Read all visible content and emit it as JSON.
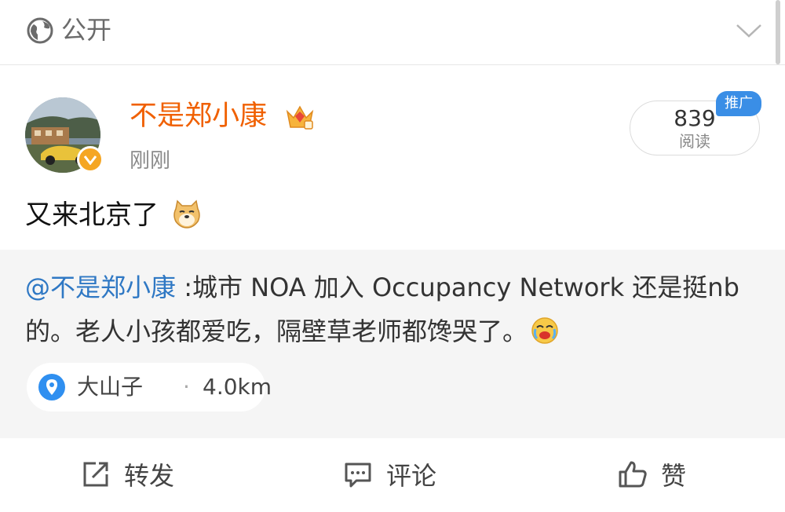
{
  "visibility": {
    "label": "公开"
  },
  "post": {
    "username": "不是郑小康",
    "time": "刚刚",
    "reads_count": "839",
    "reads_label": "阅读",
    "promo_label": "推广",
    "text": "又来北京了"
  },
  "repost": {
    "mention": "@不是郑小康",
    "text": " :城市 NOA 加入 Occupancy Network 还是挺nb 的。老人小孩都爱吃，隔壁草老师都馋哭了。",
    "location_name": "大山子",
    "location_separator": "·",
    "location_distance": "4.0km"
  },
  "actions": {
    "forward": "转发",
    "comment": "评论",
    "like": "赞"
  },
  "colors": {
    "username": "#f06000",
    "mention": "#2f78c4",
    "promo": "#3a8ee6",
    "verified_badge": "#f5a623"
  }
}
